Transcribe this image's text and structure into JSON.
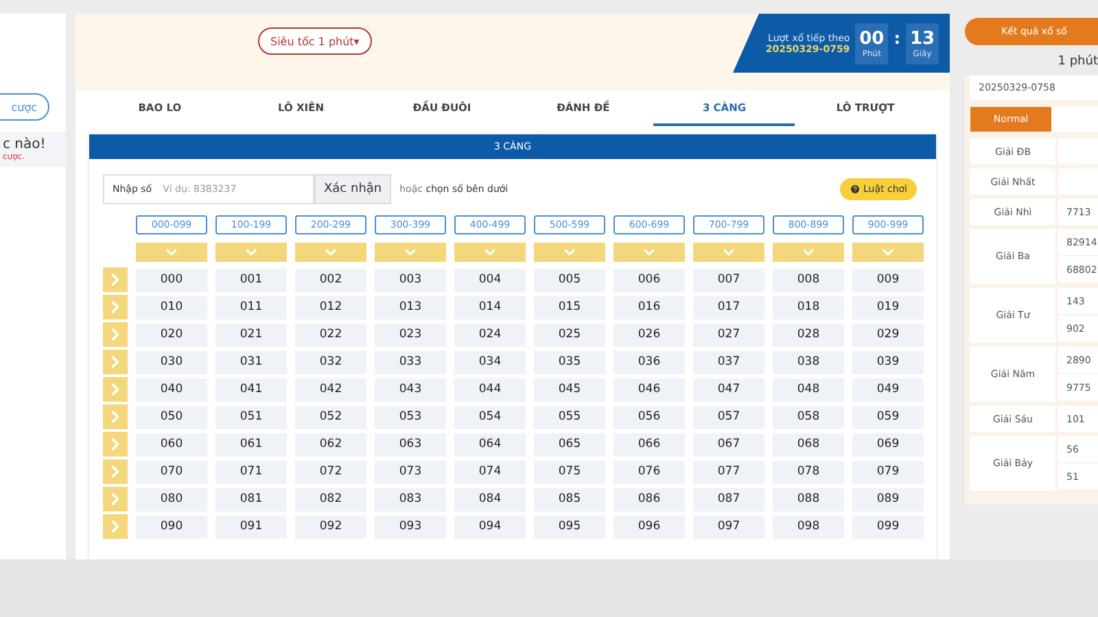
{
  "header": {
    "game_select": {
      "label": "Siêu tốc 1 phút",
      "caret": "▾"
    },
    "next_draw": {
      "label": "Lượt xổ tiếp theo",
      "draw_id": "20250329-0759",
      "minutes": "00",
      "minutes_label": "Phút",
      "separator": ":",
      "seconds": "13",
      "seconds_label": "Giây"
    }
  },
  "sidebar": {
    "bet_button": "cược",
    "notice_title": "c nào!",
    "notice_text": "cược."
  },
  "tabs": [
    {
      "label": "BAO LO",
      "selected": false
    },
    {
      "label": "LÔ XIÊN",
      "selected": false
    },
    {
      "label": "ĐẦU ĐUÔI",
      "selected": false
    },
    {
      "label": "ĐÁNH ĐỀ",
      "selected": false
    },
    {
      "label": "3 CÀNG",
      "selected": true
    },
    {
      "label": "LÔ TRƯỢT",
      "selected": false
    }
  ],
  "section_title": "3 CÀNG",
  "number_input": {
    "label": "Nhập số",
    "placeholder": "Ví dụ: 8383237",
    "button": "Xác nhận"
  },
  "hint": "hoặc **chọn số bên dưới**",
  "rules_button": "Luật chơi",
  "ranges": [
    "000-099",
    "100-199",
    "200-299",
    "300-399",
    "400-499",
    "500-599",
    "600-699",
    "700-799",
    "800-899",
    "900-999"
  ],
  "rows": [
    [
      "000",
      "001",
      "002",
      "003",
      "004",
      "005",
      "006",
      "007",
      "008",
      "009"
    ],
    [
      "010",
      "011",
      "012",
      "013",
      "014",
      "015",
      "016",
      "017",
      "018",
      "019"
    ],
    [
      "020",
      "021",
      "022",
      "023",
      "024",
      "025",
      "026",
      "027",
      "028",
      "029"
    ],
    [
      "030",
      "031",
      "032",
      "033",
      "034",
      "035",
      "036",
      "037",
      "038",
      "039"
    ],
    [
      "040",
      "041",
      "042",
      "043",
      "044",
      "045",
      "046",
      "047",
      "048",
      "049"
    ],
    [
      "050",
      "051",
      "052",
      "053",
      "054",
      "055",
      "056",
      "057",
      "058",
      "059"
    ],
    [
      "060",
      "061",
      "062",
      "063",
      "064",
      "065",
      "066",
      "067",
      "068",
      "069"
    ],
    [
      "070",
      "071",
      "072",
      "073",
      "074",
      "075",
      "076",
      "077",
      "078",
      "079"
    ],
    [
      "080",
      "081",
      "082",
      "083",
      "084",
      "085",
      "086",
      "087",
      "088",
      "089"
    ],
    [
      "090",
      "091",
      "092",
      "093",
      "094",
      "095",
      "096",
      "097",
      "098",
      "099"
    ]
  ],
  "results": {
    "button": "Kết quả xổ số",
    "mode": "1 phút",
    "draw_id": "20250329-0758",
    "toggles": [
      {
        "label": "Normal",
        "selected": true
      },
      {
        "selected": false
      }
    ],
    "prizes": [
      {
        "name": "Giải ĐB"
      },
      {
        "name": "Giải Nhất"
      },
      {
        "name": "Giải Nhì",
        "values": [
          "7713"
        ]
      },
      {
        "name": "Giải Ba",
        "values": [
          "82914",
          "68802"
        ]
      },
      {
        "name": "Giải Tư",
        "values": [
          "143",
          "902"
        ]
      },
      {
        "name": "Giải Năm",
        "values": [
          "2890",
          "9775"
        ]
      },
      {
        "name": "Giải Sáu",
        "values": [
          "101"
        ]
      },
      {
        "name": "Giải Bảy",
        "values": [
          "56",
          "51"
        ]
      }
    ]
  }
}
